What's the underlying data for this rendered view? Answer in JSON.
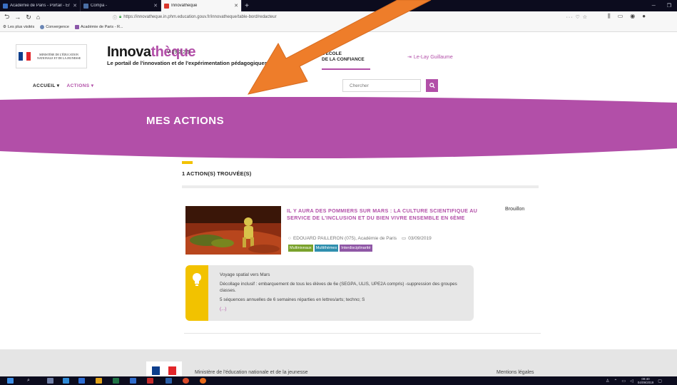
{
  "browser": {
    "tabs": [
      {
        "label": "Académie de Paris - Portail - Er",
        "active": false
      },
      {
        "label": "Compa -",
        "active": false
      },
      {
        "label": "Innovatheque",
        "active": true
      }
    ],
    "url": "https://innovatheque.in.phm.education.gouv.fr/innovatheque/table-bord/redacteur",
    "url_actions": "··· ♡ ☆",
    "bookmarks": [
      "Les plus visités",
      "Convergence",
      "Académie de Paris - R..."
    ]
  },
  "header": {
    "ministere_text": "MINISTÈRE DE L'ÉDUCATION NATIONALE ET DE LA JEUNESSE",
    "logo_prefix": "Innova",
    "logo_accent": "thèque",
    "version": "V 19.2.2.5",
    "tagline": "Le portail de l'innovation et de l'expérimentation pédagogiques",
    "ecole_line1": "L'ÉCOLE",
    "ecole_line2": "DE LA CONFIANCE",
    "user": "Le-Lay Guillaume"
  },
  "nav": {
    "accueil": "ACCUEIL",
    "actions": "ACTIONS"
  },
  "search": {
    "placeholder": "Chercher"
  },
  "banner": {
    "title": "MES ACTIONS"
  },
  "results": {
    "count": "1 ACTION(S) TROUVÉE(S)",
    "items": [
      {
        "title": "IL Y AURA DES POMMIERS SUR MARS : LA CULTURE SCIENTIFIQUE AU SERVICE DE L'INCLUSION ET DU BIEN VIVRE ENSEMBLE EN 6ÈME",
        "status": "Brouillon",
        "school": "EDOUARD PAILLERON (075), Académie de Paris",
        "date": "03/09/2019",
        "badges": [
          {
            "label": "Multiniveaux",
            "color": "#7aa22c"
          },
          {
            "label": "Multithèmes",
            "color": "#2f8fae"
          },
          {
            "label": "Interdisciplinarité",
            "color": "#8f57a6"
          }
        ],
        "desc_title": "Voyage spatial vers Mars",
        "desc_body": "Décollage inclusif : embarquement de tous les élèves de 6e (SEGPA, ULIS, UPE2A compris) -suppression des groupes classes.",
        "desc_body2": "5 séquences annuelles de 6 semaines réparties en lettres/arts; techno; S",
        "desc_more": "(...)"
      }
    ]
  },
  "footer": {
    "left": "Ministère de l'éducation nationale et de la jeunesse",
    "right": "Mentions légales"
  },
  "taskbar": {
    "time": "09:40",
    "date": "04/09/2019"
  },
  "colors": {
    "accent": "#b24fa8",
    "yellow": "#f2c200",
    "arrow": "#ee7d2a"
  }
}
